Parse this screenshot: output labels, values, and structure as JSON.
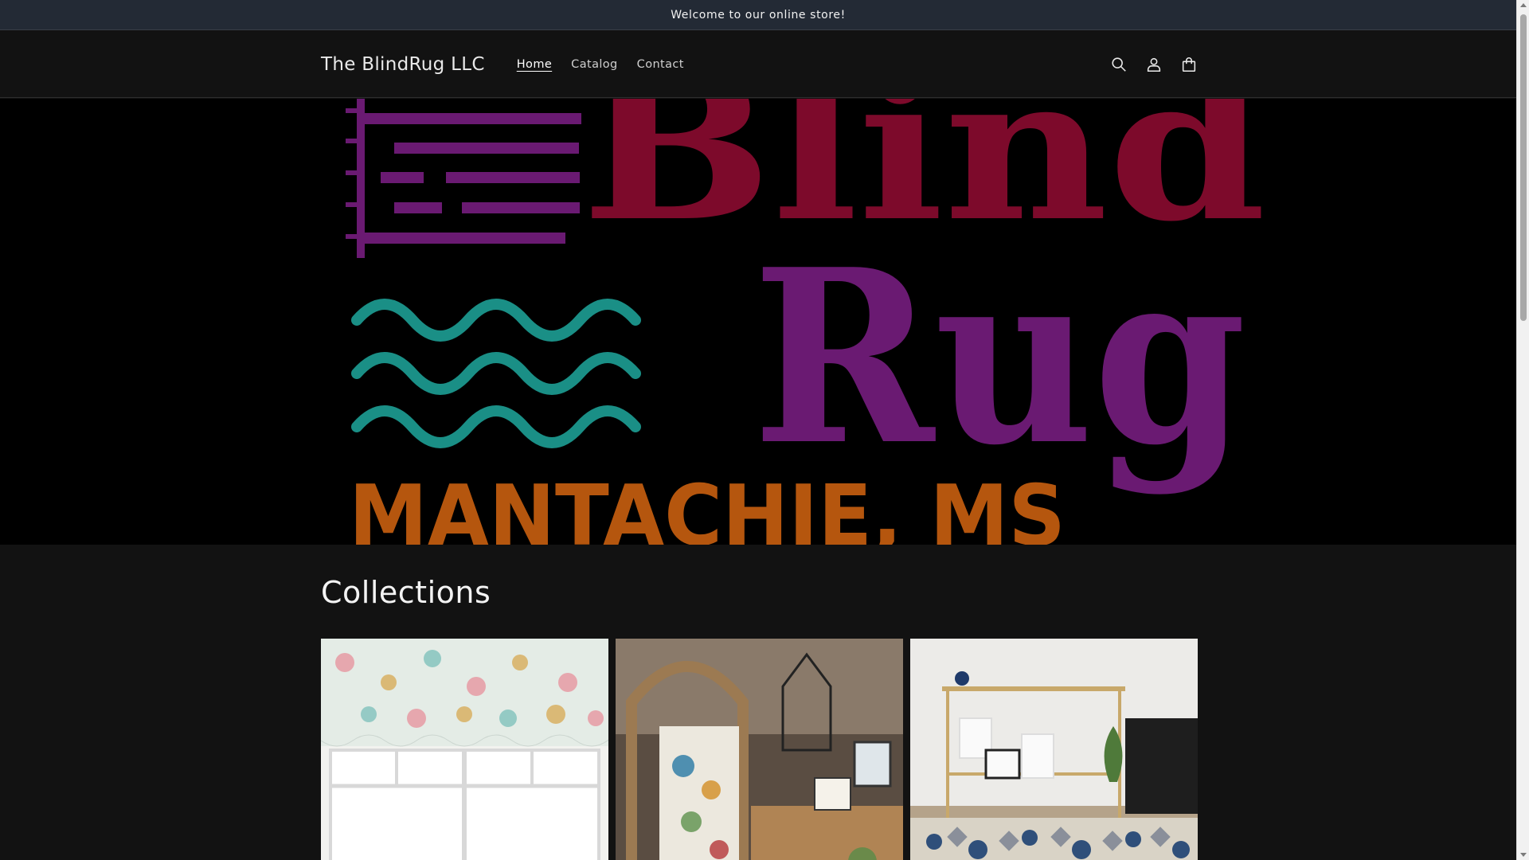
{
  "announcement": {
    "text": "Welcome to our online store!"
  },
  "header": {
    "brand": "The BlindRug LLC",
    "nav": [
      {
        "label": "Home",
        "active": true
      },
      {
        "label": "Catalog",
        "active": false
      },
      {
        "label": "Contact",
        "active": false
      }
    ],
    "icons": [
      "search-icon",
      "account-icon",
      "cart-icon"
    ]
  },
  "hero": {
    "logo_line1": "Blind",
    "logo_line2": "Rug",
    "logo_line3": "MANTACHIE, MS",
    "colors": {
      "blind": "#7d0a2b",
      "rug": "#6a1a72",
      "waves": "#1a8f86",
      "location": "#b5560e",
      "blinds_icon": "#6a1a72"
    }
  },
  "collections": {
    "heading": "Collections",
    "cards": [
      {
        "name": "collection-card-valances"
      },
      {
        "name": "collection-card-decor"
      },
      {
        "name": "collection-card-rugs"
      }
    ]
  }
}
